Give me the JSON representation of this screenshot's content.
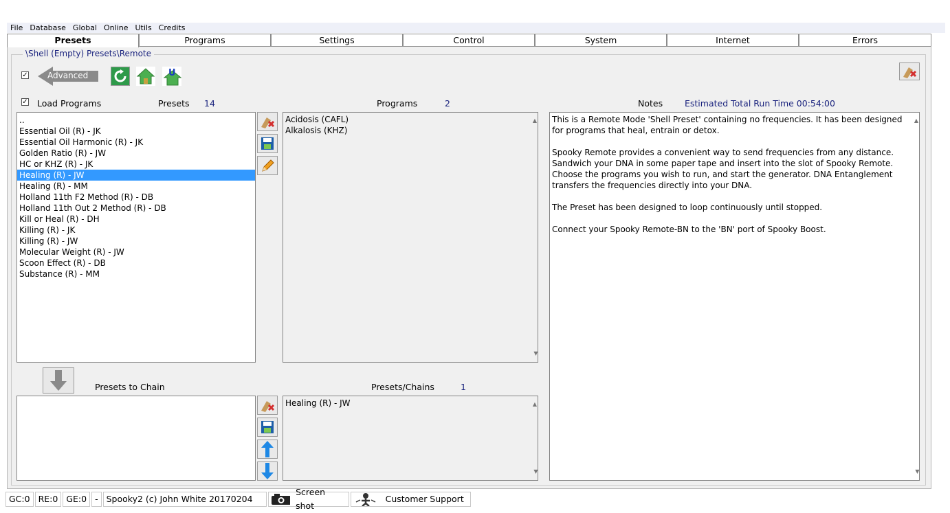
{
  "menu": [
    "File",
    "Database",
    "Global",
    "Online",
    "Utils",
    "Credits"
  ],
  "tabs": [
    "Presets",
    "Programs",
    "Settings",
    "Control",
    "System",
    "Internet",
    "Errors"
  ],
  "path": "\\Shell (Empty) Presets\\Remote",
  "advanced_label": "Advanced",
  "load_programs_label": "Load Programs",
  "presets_header": {
    "label": "Presets",
    "count": "14"
  },
  "programs_header": {
    "label": "Programs",
    "count": "2"
  },
  "notes_header": {
    "label": "Notes",
    "runtime": "Estimated Total Run Time 00:54:00"
  },
  "presets": [
    "..",
    "Essential Oil (R) - JK",
    "Essential Oil Harmonic (R) - JK",
    "Golden Ratio (R) - JW",
    "HC or KHZ (R) - JK",
    "Healing (R) - JW",
    "Healing (R) - MM",
    "Holland 11th F2 Method (R) - DB",
    "Holland 11th Out 2 Method (R) - DB",
    "Kill or Heal (R) - DH",
    "Killing (R) - JK",
    "Killing (R) - JW",
    "Molecular Weight (R) - JW",
    "Scoon Effect (R) - DB",
    "Substance (R) - MM"
  ],
  "selected_preset": "Healing (R) - JW",
  "programs": [
    "Acidosis (CAFL)",
    "Alkalosis (KHZ)"
  ],
  "notes": [
    "This is a Remote Mode 'Shell Preset' containing no frequencies. It has been designed for programs that heal, entrain or detox.",
    "Spooky Remote provides a convenient way to send frequencies from any distance. Sandwich your DNA in some paper tape and insert into the slot of Spooky Remote. Choose the programs you wish to run, and start the generator. DNA Entanglement transfers the frequencies directly into your DNA.",
    "The Preset has been designed to loop continuously until stopped.",
    "Connect your Spooky Remote-BN to the 'BN' port of Spooky Boost."
  ],
  "presets_to_chain_label": "Presets to Chain",
  "chains_header": {
    "label": "Presets/Chains",
    "count": "1"
  },
  "chains": [
    "Healing (R) - JW"
  ],
  "status": {
    "gc": "GC:0",
    "re": "RE:0",
    "ge": "GE:0",
    "dash": "-",
    "copyright": "Spooky2 (c) John White 20170204",
    "screenshot": "Screen shot",
    "support": "Customer Support"
  }
}
